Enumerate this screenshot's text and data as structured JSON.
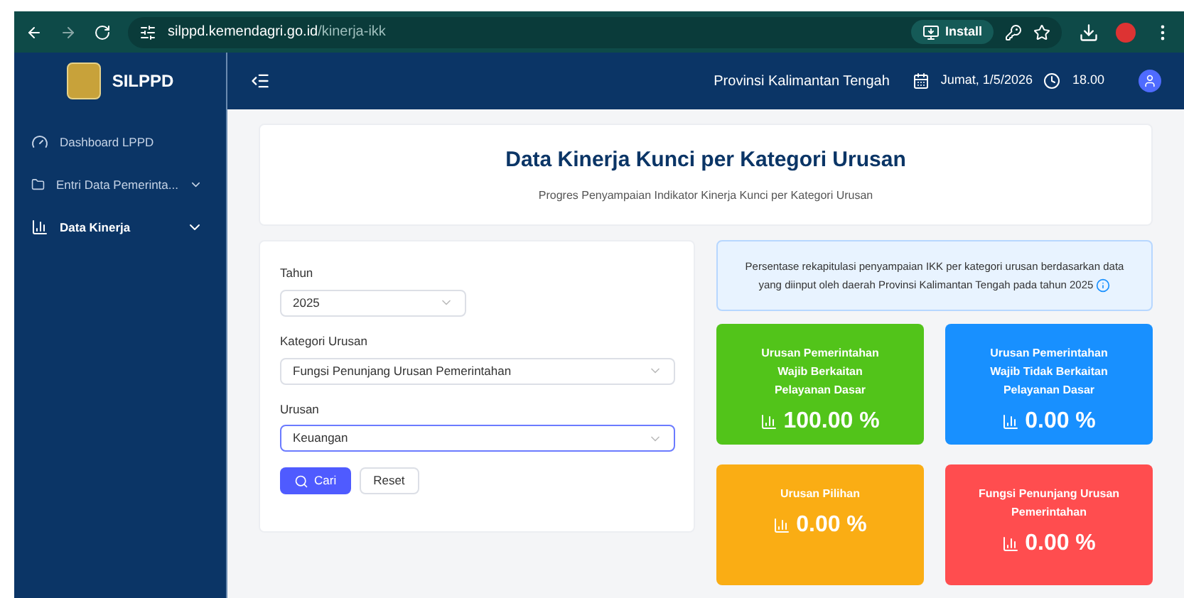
{
  "browser": {
    "url_host": "silppd.kemendagri.go.id",
    "url_path": "/kinerja-ikk",
    "install_label": "Install"
  },
  "header": {
    "brand": "SILPPD",
    "province": "Provinsi Kalimantan Tengah",
    "date": "Jumat, 1/5/2026",
    "time": "18.00"
  },
  "sidebar": {
    "items": [
      {
        "label": "Dashboard LPPD",
        "kind": "dashboard",
        "expandable": false,
        "selected": false
      },
      {
        "label": "Entri Data Pemerinta...",
        "kind": "folder",
        "expandable": true,
        "selected": false
      },
      {
        "label": "Data Kinerja",
        "kind": "chart",
        "expandable": true,
        "selected": true
      }
    ]
  },
  "page": {
    "title": "Data Kinerja Kunci per Kategori Urusan",
    "subtitle": "Progres Penyampaian Indikator Kinerja Kunci per Kategori Urusan"
  },
  "filters": {
    "fields": [
      {
        "label": "Tahun",
        "value": "2025",
        "wide": false,
        "focused": false
      },
      {
        "label": "Kategori Urusan",
        "value": "Fungsi Penunjang Urusan Pemerintahan",
        "wide": true,
        "focused": false
      },
      {
        "label": "Urusan",
        "value": "Keuangan",
        "wide": true,
        "focused": true
      }
    ],
    "search_button": "Cari",
    "reset_button": "Reset"
  },
  "info": "Persentase rekapitulasi penyampaian IKK per kategori urusan berdasarkan data yang diinput oleh daerah Provinsi Kalimantan Tengah pada tahun 2025",
  "cards": [
    {
      "title": "Urusan Pemerintahan Wajib Berkaitan Pelayanan Dasar",
      "value": "100.00 %",
      "color": "#52c41a"
    },
    {
      "title": "Urusan Pemerintahan Wajib Tidak Berkaitan Pelayanan Dasar",
      "value": "0.00 %",
      "color": "#1890ff"
    },
    {
      "title": "Urusan Pilihan",
      "value": "0.00 %",
      "color": "#faad14"
    },
    {
      "title": "Fungsi Penunjang Urusan Pemerintahan",
      "value": "0.00 %",
      "color": "#ff4d4f"
    }
  ]
}
